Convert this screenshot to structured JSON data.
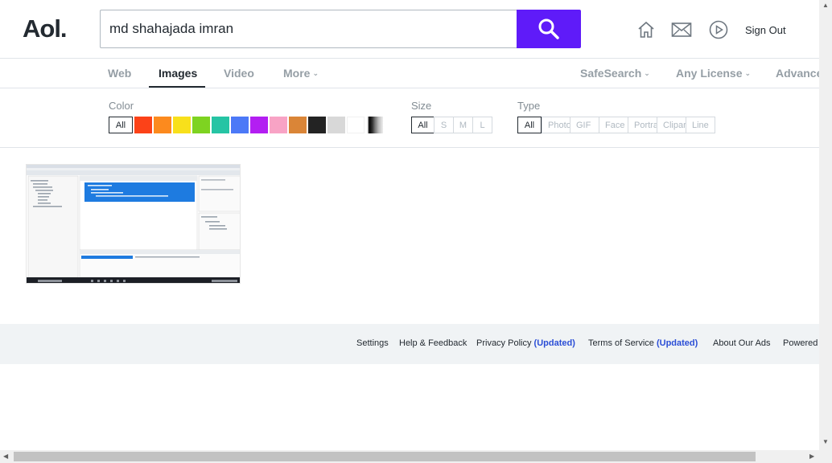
{
  "header": {
    "logo": "Aol.",
    "search_value": "md shahajada imran",
    "sign_out": "Sign Out"
  },
  "tabs": {
    "web": "Web",
    "images": "Images",
    "video": "Video",
    "more": "More",
    "safesearch": "SafeSearch",
    "license": "Any License",
    "advanced": "Advanced"
  },
  "filters": {
    "color_label": "Color",
    "color_all": "All",
    "colors": [
      "#fc4218",
      "#fc8a1e",
      "#f8e01b",
      "#7ed321",
      "#26c4a4",
      "#4c79f7",
      "#b31ef2",
      "#f8a3c5",
      "#da8537",
      "#232323",
      "#d8d8d8",
      "#ffffff"
    ],
    "size_label": "Size",
    "sizes": [
      "All",
      "S",
      "M",
      "L"
    ],
    "type_label": "Type",
    "types": [
      "All",
      "Photo",
      "GIF",
      "Face",
      "Portrait",
      "Clipart",
      "Line"
    ]
  },
  "footer": {
    "settings": "Settings",
    "help": "Help & Feedback",
    "privacy": "Privacy Policy",
    "privacy_updated": "(Updated)",
    "terms": "Terms of Service",
    "terms_updated": "(Updated)",
    "about_ads": "About Our Ads",
    "powered": "Powered"
  }
}
